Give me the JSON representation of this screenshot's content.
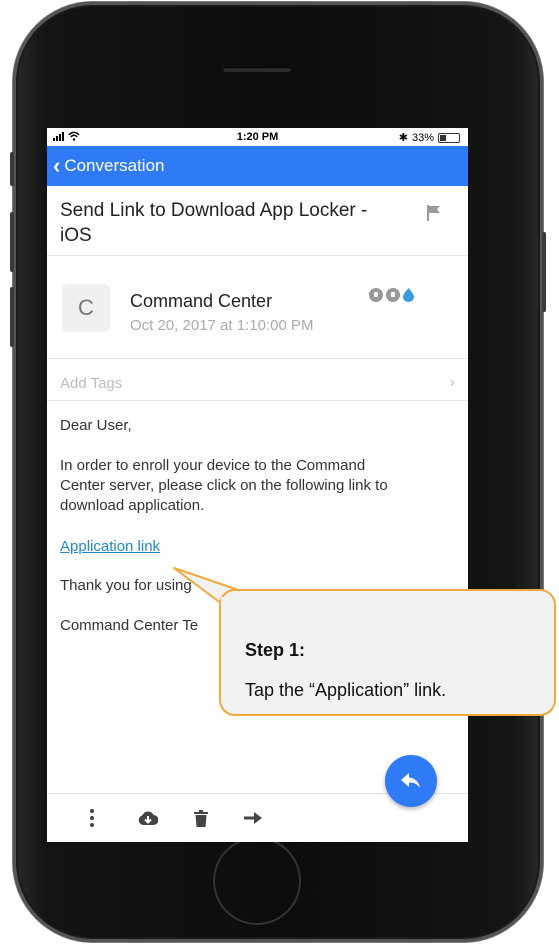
{
  "status_bar": {
    "time": "1:20 PM",
    "battery_percent": "33%",
    "signal": "•ııl"
  },
  "navbar": {
    "back_label": "Conversation"
  },
  "email": {
    "subject": "Send Link to Download App Locker - iOS",
    "avatar_initial": "C",
    "sender": "Command Center",
    "date": "Oct 20, 2017 at 1:10:00 PM",
    "tags_placeholder": "Add Tags",
    "greeting": "Dear User,",
    "body": "In order to enroll your device to the Command Center server, please click on the following link to download application.",
    "link_text": "Application link",
    "thanks": "Thank you for using",
    "signature": "Command Center Te"
  },
  "callout": {
    "title": "Step 1:",
    "text": "Tap the “Application” link."
  },
  "icons": [
    "back-chevron-icon",
    "flag-icon",
    "shield-icon",
    "lock-icon",
    "drop-icon",
    "chevron-right-icon",
    "reply-icon",
    "more-vertical-icon",
    "cloud-download-icon",
    "trash-icon",
    "arrow-right-icon"
  ],
  "colors": {
    "accent": "#2f7af7",
    "link": "#1e88d0",
    "callout_border": "#f2a93b"
  }
}
